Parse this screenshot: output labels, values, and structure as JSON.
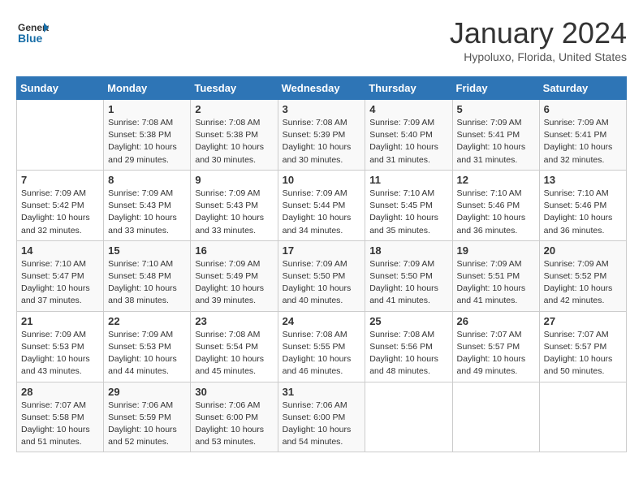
{
  "logo": {
    "general": "General",
    "blue": "Blue"
  },
  "title": "January 2024",
  "subtitle": "Hypoluxo, Florida, United States",
  "days_header": [
    "Sunday",
    "Monday",
    "Tuesday",
    "Wednesday",
    "Thursday",
    "Friday",
    "Saturday"
  ],
  "weeks": [
    [
      {
        "day": "",
        "sunrise": "",
        "sunset": "",
        "daylight": ""
      },
      {
        "day": "1",
        "sunrise": "Sunrise: 7:08 AM",
        "sunset": "Sunset: 5:38 PM",
        "daylight": "Daylight: 10 hours and 29 minutes."
      },
      {
        "day": "2",
        "sunrise": "Sunrise: 7:08 AM",
        "sunset": "Sunset: 5:38 PM",
        "daylight": "Daylight: 10 hours and 30 minutes."
      },
      {
        "day": "3",
        "sunrise": "Sunrise: 7:08 AM",
        "sunset": "Sunset: 5:39 PM",
        "daylight": "Daylight: 10 hours and 30 minutes."
      },
      {
        "day": "4",
        "sunrise": "Sunrise: 7:09 AM",
        "sunset": "Sunset: 5:40 PM",
        "daylight": "Daylight: 10 hours and 31 minutes."
      },
      {
        "day": "5",
        "sunrise": "Sunrise: 7:09 AM",
        "sunset": "Sunset: 5:41 PM",
        "daylight": "Daylight: 10 hours and 31 minutes."
      },
      {
        "day": "6",
        "sunrise": "Sunrise: 7:09 AM",
        "sunset": "Sunset: 5:41 PM",
        "daylight": "Daylight: 10 hours and 32 minutes."
      }
    ],
    [
      {
        "day": "7",
        "sunrise": "Sunrise: 7:09 AM",
        "sunset": "Sunset: 5:42 PM",
        "daylight": "Daylight: 10 hours and 32 minutes."
      },
      {
        "day": "8",
        "sunrise": "Sunrise: 7:09 AM",
        "sunset": "Sunset: 5:43 PM",
        "daylight": "Daylight: 10 hours and 33 minutes."
      },
      {
        "day": "9",
        "sunrise": "Sunrise: 7:09 AM",
        "sunset": "Sunset: 5:43 PM",
        "daylight": "Daylight: 10 hours and 33 minutes."
      },
      {
        "day": "10",
        "sunrise": "Sunrise: 7:09 AM",
        "sunset": "Sunset: 5:44 PM",
        "daylight": "Daylight: 10 hours and 34 minutes."
      },
      {
        "day": "11",
        "sunrise": "Sunrise: 7:10 AM",
        "sunset": "Sunset: 5:45 PM",
        "daylight": "Daylight: 10 hours and 35 minutes."
      },
      {
        "day": "12",
        "sunrise": "Sunrise: 7:10 AM",
        "sunset": "Sunset: 5:46 PM",
        "daylight": "Daylight: 10 hours and 36 minutes."
      },
      {
        "day": "13",
        "sunrise": "Sunrise: 7:10 AM",
        "sunset": "Sunset: 5:46 PM",
        "daylight": "Daylight: 10 hours and 36 minutes."
      }
    ],
    [
      {
        "day": "14",
        "sunrise": "Sunrise: 7:10 AM",
        "sunset": "Sunset: 5:47 PM",
        "daylight": "Daylight: 10 hours and 37 minutes."
      },
      {
        "day": "15",
        "sunrise": "Sunrise: 7:10 AM",
        "sunset": "Sunset: 5:48 PM",
        "daylight": "Daylight: 10 hours and 38 minutes."
      },
      {
        "day": "16",
        "sunrise": "Sunrise: 7:09 AM",
        "sunset": "Sunset: 5:49 PM",
        "daylight": "Daylight: 10 hours and 39 minutes."
      },
      {
        "day": "17",
        "sunrise": "Sunrise: 7:09 AM",
        "sunset": "Sunset: 5:50 PM",
        "daylight": "Daylight: 10 hours and 40 minutes."
      },
      {
        "day": "18",
        "sunrise": "Sunrise: 7:09 AM",
        "sunset": "Sunset: 5:50 PM",
        "daylight": "Daylight: 10 hours and 41 minutes."
      },
      {
        "day": "19",
        "sunrise": "Sunrise: 7:09 AM",
        "sunset": "Sunset: 5:51 PM",
        "daylight": "Daylight: 10 hours and 41 minutes."
      },
      {
        "day": "20",
        "sunrise": "Sunrise: 7:09 AM",
        "sunset": "Sunset: 5:52 PM",
        "daylight": "Daylight: 10 hours and 42 minutes."
      }
    ],
    [
      {
        "day": "21",
        "sunrise": "Sunrise: 7:09 AM",
        "sunset": "Sunset: 5:53 PM",
        "daylight": "Daylight: 10 hours and 43 minutes."
      },
      {
        "day": "22",
        "sunrise": "Sunrise: 7:09 AM",
        "sunset": "Sunset: 5:53 PM",
        "daylight": "Daylight: 10 hours and 44 minutes."
      },
      {
        "day": "23",
        "sunrise": "Sunrise: 7:08 AM",
        "sunset": "Sunset: 5:54 PM",
        "daylight": "Daylight: 10 hours and 45 minutes."
      },
      {
        "day": "24",
        "sunrise": "Sunrise: 7:08 AM",
        "sunset": "Sunset: 5:55 PM",
        "daylight": "Daylight: 10 hours and 46 minutes."
      },
      {
        "day": "25",
        "sunrise": "Sunrise: 7:08 AM",
        "sunset": "Sunset: 5:56 PM",
        "daylight": "Daylight: 10 hours and 48 minutes."
      },
      {
        "day": "26",
        "sunrise": "Sunrise: 7:07 AM",
        "sunset": "Sunset: 5:57 PM",
        "daylight": "Daylight: 10 hours and 49 minutes."
      },
      {
        "day": "27",
        "sunrise": "Sunrise: 7:07 AM",
        "sunset": "Sunset: 5:57 PM",
        "daylight": "Daylight: 10 hours and 50 minutes."
      }
    ],
    [
      {
        "day": "28",
        "sunrise": "Sunrise: 7:07 AM",
        "sunset": "Sunset: 5:58 PM",
        "daylight": "Daylight: 10 hours and 51 minutes."
      },
      {
        "day": "29",
        "sunrise": "Sunrise: 7:06 AM",
        "sunset": "Sunset: 5:59 PM",
        "daylight": "Daylight: 10 hours and 52 minutes."
      },
      {
        "day": "30",
        "sunrise": "Sunrise: 7:06 AM",
        "sunset": "Sunset: 6:00 PM",
        "daylight": "Daylight: 10 hours and 53 minutes."
      },
      {
        "day": "31",
        "sunrise": "Sunrise: 7:06 AM",
        "sunset": "Sunset: 6:00 PM",
        "daylight": "Daylight: 10 hours and 54 minutes."
      },
      {
        "day": "",
        "sunrise": "",
        "sunset": "",
        "daylight": ""
      },
      {
        "day": "",
        "sunrise": "",
        "sunset": "",
        "daylight": ""
      },
      {
        "day": "",
        "sunrise": "",
        "sunset": "",
        "daylight": ""
      }
    ]
  ]
}
